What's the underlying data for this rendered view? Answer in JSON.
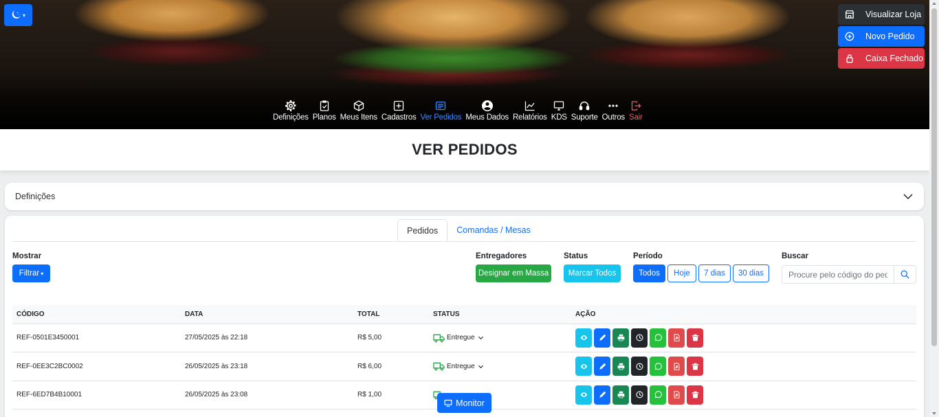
{
  "header": {
    "side_buttons": [
      {
        "label": "Visualizar Loja",
        "icon": "store-icon"
      },
      {
        "label": "Novo Pedido",
        "icon": "plus-circle-icon"
      },
      {
        "label": "Caixa Fechado",
        "icon": "lock-icon"
      }
    ],
    "nav": [
      {
        "label": "Definições",
        "icon": "gear-icon"
      },
      {
        "label": "Planos",
        "icon": "clipboard-check-icon"
      },
      {
        "label": "Meus Itens",
        "icon": "box-icon"
      },
      {
        "label": "Cadastros",
        "icon": "plus-square-icon"
      },
      {
        "label": "Ver Pedidos",
        "icon": "list-icon",
        "active": true
      },
      {
        "label": "Meus Dados",
        "icon": "user-circle-icon"
      },
      {
        "label": "Relatórios",
        "icon": "chart-line-icon"
      },
      {
        "label": "KDS",
        "icon": "monitor-icon"
      },
      {
        "label": "Suporte",
        "icon": "headset-icon"
      },
      {
        "label": "Outros",
        "icon": "dots-icon"
      },
      {
        "label": "Sair",
        "icon": "logout-icon"
      }
    ]
  },
  "page_title": "VER PEDIDOS",
  "definitions": {
    "label": "Definições"
  },
  "tabs": [
    "Pedidos",
    "Comandas / Mesas"
  ],
  "filters": {
    "mostrar_label": "Mostrar",
    "filtrar_button": "Filtrar",
    "entregadores_label": "Entregadores",
    "designar_button": "Designar em Massa",
    "status_label": "Status",
    "marcar_button": "Marcar Todos",
    "periodo_label": "Período",
    "periods": [
      "Todos",
      "Hoje",
      "7 dias",
      "30 dias"
    ],
    "selected_period": "Todos",
    "buscar_label": "Buscar",
    "search_placeholder": "Procure pelo código do pedido"
  },
  "table": {
    "headers": [
      "CÓDIGO",
      "DATA",
      "TOTAL",
      "STATUS",
      "AÇÃO"
    ],
    "rows": [
      {
        "codigo": "REF-0501E3450001",
        "data": "27/05/2025 às 22:18",
        "total": "R$ 5,00",
        "status": "Entregue"
      },
      {
        "codigo": "REF-0EE3C2BC0002",
        "data": "26/05/2025 às 23:18",
        "total": "R$ 6,00",
        "status": "Entregue"
      },
      {
        "codigo": "REF-6ED7B4B10001",
        "data": "26/05/2025 às 23:08",
        "total": "R$ 1,00",
        "status": ""
      }
    ]
  },
  "monitor_button": "Monitor",
  "colors": {
    "primary": "#0d6efd",
    "danger": "#dc3545",
    "success": "#28a745",
    "info": "#16c4ec"
  }
}
